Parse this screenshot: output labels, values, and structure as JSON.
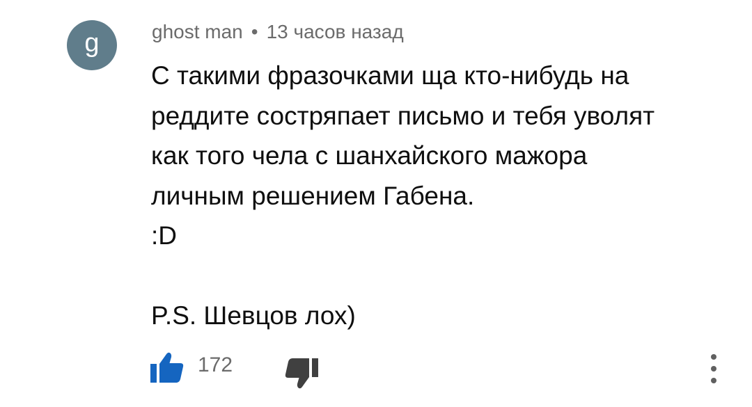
{
  "comment": {
    "avatar_letter": "g",
    "author": "ghost man",
    "separator": "•",
    "timestamp": "13 часов назад",
    "lines": [
      "С такими фразочками ща кто-нибудь на",
      "реддите состряпает письмо и тебя уволят",
      "как того чела с шанхайского мажора",
      "личным решением Габена.",
      ":D",
      "",
      "P.S. Шевцов лох)"
    ],
    "like_count": "172"
  },
  "icons": {
    "like": "thumbs-up-icon",
    "dislike": "thumbs-down-icon",
    "more": "more-vertical-icon"
  },
  "colors": {
    "avatar_bg": "#607d8b",
    "like_icon": "#1565c0",
    "dislike_icon": "#404040",
    "meta_text": "#6b6b6b",
    "body_text": "#0f0f0f"
  }
}
